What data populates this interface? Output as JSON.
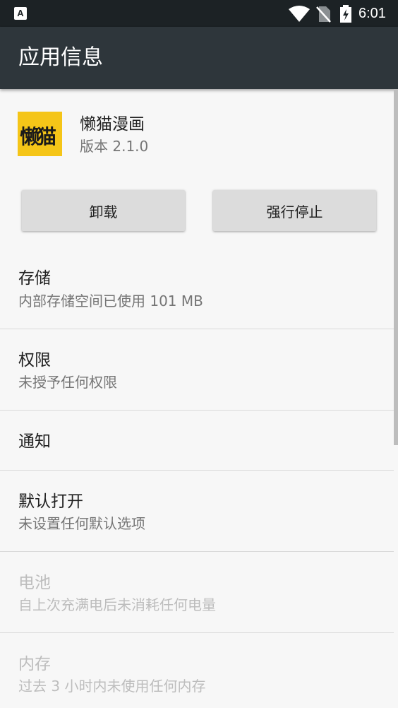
{
  "status_bar": {
    "time": "6:01",
    "notification_icon_letter": "A",
    "icons": [
      "wifi-icon",
      "no-sim-icon",
      "battery-charging-icon"
    ]
  },
  "app_bar": {
    "title": "应用信息"
  },
  "app": {
    "icon_text": "懒猫",
    "icon_color": "#f5c518",
    "name": "懒猫漫画",
    "version": "版本 2.1.0"
  },
  "buttons": {
    "uninstall": "卸载",
    "force_stop": "强行停止"
  },
  "settings": [
    {
      "title": "存储",
      "subtitle": "内部存储空间已使用 101 MB",
      "enabled": true
    },
    {
      "title": "权限",
      "subtitle": "未授予任何权限",
      "enabled": true
    },
    {
      "title": "通知",
      "subtitle": "",
      "enabled": true
    },
    {
      "title": "默认打开",
      "subtitle": "未设置任何默认选项",
      "enabled": true
    },
    {
      "title": "电池",
      "subtitle": "自上次充满电后未消耗任何电量",
      "enabled": false
    },
    {
      "title": "内存",
      "subtitle": "过去 3 小时内未使用任何内存",
      "enabled": false
    }
  ],
  "colors": {
    "status_bar": "#1c2225",
    "app_bar": "#2e363b",
    "background": "#f7f7f7",
    "button": "#dcdcdc",
    "disabled_text": "#bdbdbd"
  }
}
